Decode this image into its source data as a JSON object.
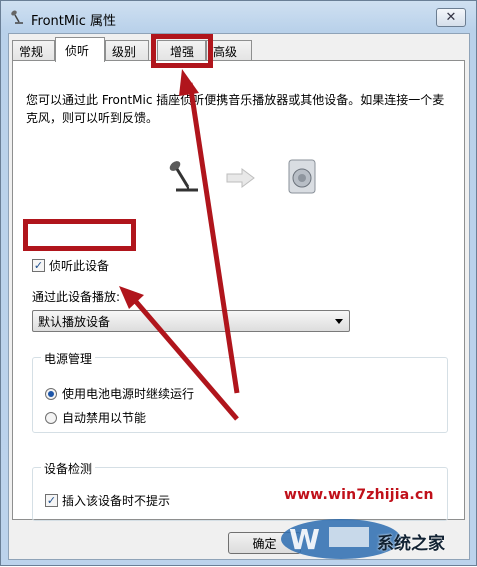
{
  "window": {
    "title": "FrontMic 属性",
    "close_label": "✕"
  },
  "tabs": [
    {
      "label": "常规",
      "active": false
    },
    {
      "label": "侦听",
      "active": true
    },
    {
      "label": "级别",
      "active": false
    },
    {
      "label": "增强",
      "active": false
    },
    {
      "label": "高级",
      "active": false
    }
  ],
  "listen": {
    "description": "您可以通过此 FrontMic 插座侦听便携音乐播放器或其他设备。如果连接一个麦克风，则可以听到反馈。",
    "listen_checkbox": {
      "label": "侦听此设备",
      "checked": true
    },
    "playback_label": "通过此设备播放:",
    "playback_select": {
      "value": "默认播放设备"
    }
  },
  "power": {
    "title": "电源管理",
    "options": [
      {
        "label": "使用电池电源时继续运行",
        "selected": true
      },
      {
        "label": "自动禁用以节能",
        "selected": false
      }
    ]
  },
  "detection": {
    "title": "设备检测",
    "checkbox": {
      "label": "插入该设备时不提示",
      "checked": true
    }
  },
  "buttons": {
    "ok": "确定"
  },
  "watermark": {
    "url": "www.win7zhijia.cn",
    "brand": "系统之家"
  },
  "colors": {
    "annotation_red": "#b0151c",
    "titlebar": "#b9d1ea"
  }
}
